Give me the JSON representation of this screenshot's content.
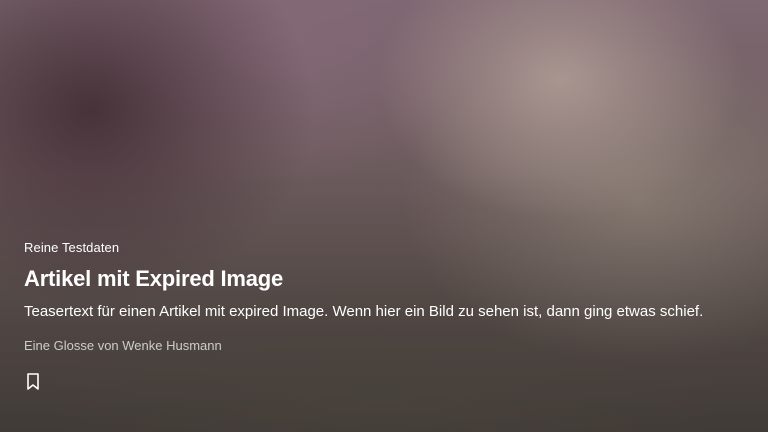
{
  "teaser_card": {
    "kicker": "Reine Testdaten",
    "title": "Artikel mit Expired Image",
    "teaser": "Teasertext für einen Artikel mit expired Image. Wenn hier ein Bild zu sehen ist, dann ging etwas schief.",
    "byline": "Eine Glosse von Wenke Husmann",
    "bookmark_icon": "bookmark-icon"
  },
  "colors": {
    "text": "#ffffff",
    "byline_text": "#c9c2c0"
  }
}
